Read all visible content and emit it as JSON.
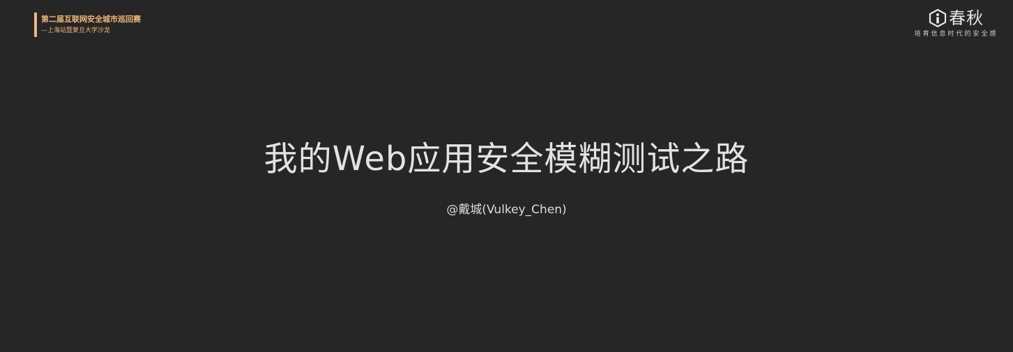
{
  "event": {
    "title": "第二届互联网安全城市巡回赛",
    "subtitle": "—上海站暨复旦大学沙龙"
  },
  "brand": {
    "name": "春秋",
    "slogan": "培育信息时代的安全感",
    "logo_icon": "i-hexagon-logo",
    "accent_color": "#f0b77a"
  },
  "slide": {
    "title": "我的Web应用安全模糊测试之路",
    "author": "@戴城(Vulkey_Chen)"
  }
}
